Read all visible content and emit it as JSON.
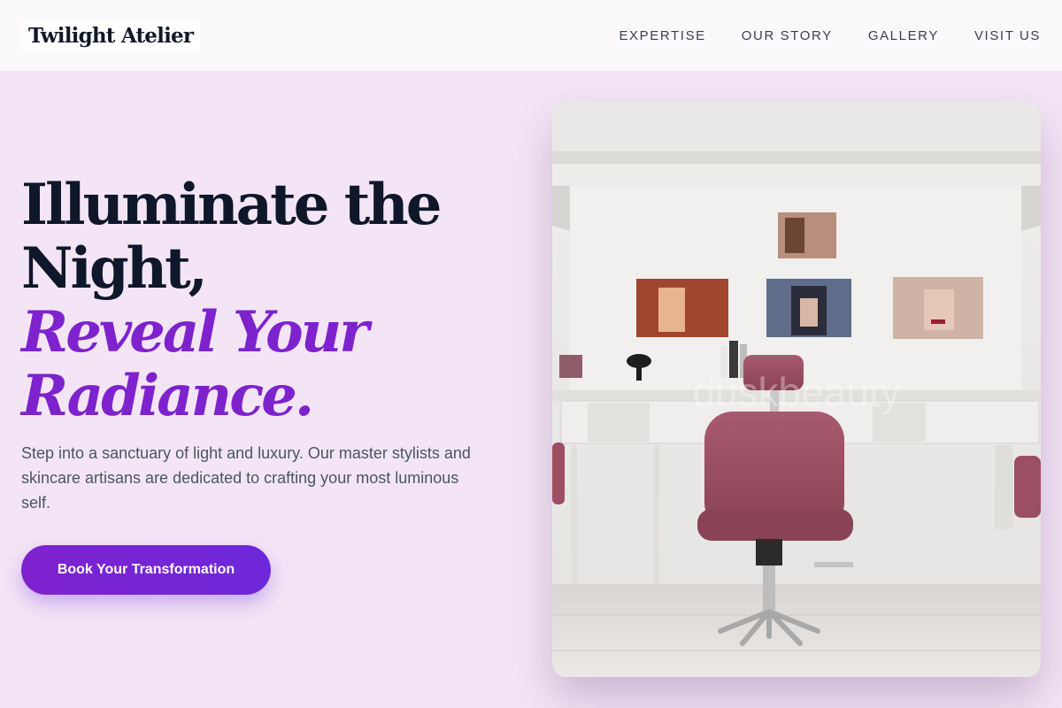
{
  "header": {
    "logo": "Twilight Atelier",
    "nav": [
      {
        "label": "EXPERTISE"
      },
      {
        "label": "OUR STORY"
      },
      {
        "label": "GALLERY"
      },
      {
        "label": "VISIT US"
      }
    ]
  },
  "hero": {
    "headline_line1": "Illuminate the",
    "headline_line2": "Night,",
    "headline_accent_line1": "Reveal Your",
    "headline_accent_line2": "Radiance.",
    "description": "Step into a sanctuary of light and luxury. Our master stylists and skincare artisans are dedicated to crafting your most luminous self.",
    "cta_label": "Book Your Transformation"
  },
  "image": {
    "subject": "salon-interior-photo",
    "watermark": "duskbeauty"
  },
  "colors": {
    "background": "#f3e5f6",
    "header_bg": "#fcf9fd",
    "heading": "#0f172a",
    "accent": "#7e22ce",
    "body_text": "#4b5563",
    "chair": "#9c4f63"
  }
}
